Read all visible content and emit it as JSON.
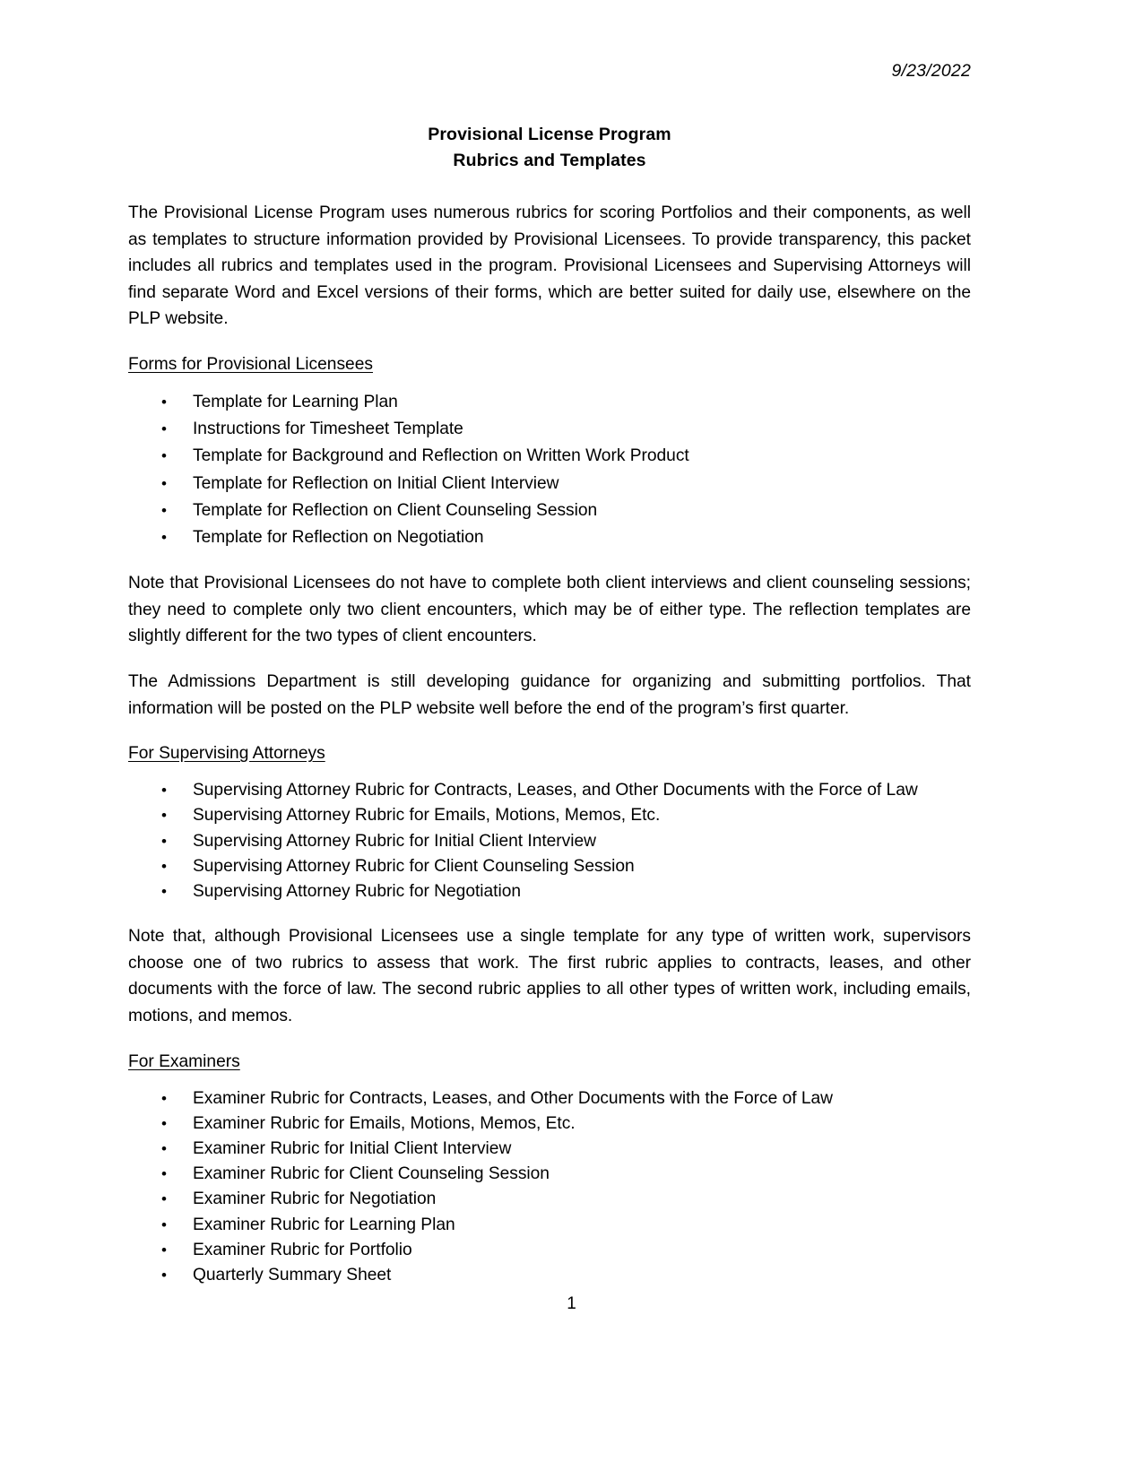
{
  "document": {
    "date": "9/23/2022",
    "title_line_1": "Provisional License Program",
    "title_line_2": "Rubrics and Templates",
    "page_number": "1",
    "bullet_glyph": "•",
    "intro_paragraph": "The Provisional License Program uses numerous rubrics for scoring Portfolios and their components, as well as templates to structure information provided by Provisional Licensees. To provide transparency, this packet includes all rubrics and templates used in the program. Provisional Licensees and Supervising Attorneys will find separate Word and Excel versions of their forms, which are better suited for daily use, elsewhere on the PLP website.",
    "note_client_encounters": "Note that Provisional Licensees do not have to complete both client interviews and client counseling sessions; they need to complete only two client encounters, which may be of either type. The reflection templates are slightly different for the two types of client encounters.",
    "note_admissions": "The Admissions Department is still developing guidance for organizing and submitting portfolios. That information will be posted on the PLP website well before the end of the program’s first quarter.",
    "note_rubric_choice": "Note that, although Provisional Licensees use a single template for any type of written work, supervisors choose one of two rubrics to assess that work. The first rubric applies to contracts, leases, and other documents with the force of law. The second rubric applies to all other types of written work, including emails, motions, and memos."
  },
  "sections": {
    "licensees": {
      "heading": "Forms for Provisional Licensees",
      "items": [
        "Template for Learning Plan",
        "Instructions for Timesheet Template",
        "Template for Background and Reflection on Written Work Product",
        "Template for Reflection on Initial Client Interview",
        "Template for Reflection on Client Counseling Session",
        "Template for Reflection on Negotiation"
      ]
    },
    "supervising_attorneys": {
      "heading": "For Supervising Attorneys",
      "items": [
        "Supervising Attorney Rubric for Contracts, Leases, and Other Documents with the Force of Law",
        "Supervising Attorney Rubric for Emails, Motions, Memos, Etc.",
        "Supervising Attorney Rubric for Initial Client Interview",
        "Supervising Attorney Rubric for Client Counseling Session",
        "Supervising Attorney Rubric for Negotiation"
      ]
    },
    "examiners": {
      "heading": "For Examiners",
      "items": [
        "Examiner Rubric for Contracts, Leases, and Other Documents with the Force of Law",
        "Examiner Rubric for Emails, Motions, Memos, Etc.",
        "Examiner Rubric for Initial Client Interview",
        "Examiner Rubric for Client Counseling Session",
        "Examiner Rubric for Negotiation",
        "Examiner Rubric for Learning Plan",
        "Examiner Rubric for Portfolio",
        "Quarterly Summary Sheet"
      ]
    }
  }
}
